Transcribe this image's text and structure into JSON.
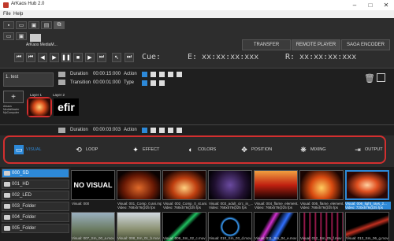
{
  "window": {
    "title": "ArKaos Hub 2.0"
  },
  "menu": [
    "File",
    "Help"
  ],
  "top_tabs": [
    "TRANSFER",
    "REMOTE PLAYER",
    "SAGA ENCODER"
  ],
  "app_label": "ArKaos MediaM...",
  "timecodes": {
    "cue": "Cue:",
    "e": "E: xx:xx:xx:xxx",
    "r": "R: xx:xx:xx:xxx"
  },
  "layer1": {
    "name": "1. test",
    "duration_label": "Duration",
    "duration_value": "00:00:15:000",
    "transition_label": "Transition",
    "transition_value": "00:00:01:000",
    "action_label": "Action",
    "type_label": "Type",
    "layer_tags": [
      "Layer 1",
      "Layer 2"
    ],
    "side_text": "Arkaos MediaMaster MyComputer"
  },
  "layer2": {
    "duration_label": "Duration",
    "duration_value": "00:00:03:003",
    "action_label": "Action"
  },
  "effects_tabs": [
    "VISUAL",
    "LOOP",
    "EFFECT",
    "COLORS",
    "POSITION",
    "MIXING",
    "OUTPUT"
  ],
  "folders": [
    "000_SD",
    "001_HD",
    "002_LED",
    "003_Folder",
    "004_Folder",
    "005_Folder"
  ],
  "thumbs_row1": [
    {
      "title": "Visual: 000",
      "sub": ""
    },
    {
      "title": "Visual: 001_Comp_0.ani.mp4",
      "sub": "Video: 768x576@25 fps"
    },
    {
      "title": "Visual: 002_Comp_0_st.ani.mp4",
      "sub": "Video: 768x576@25 fps"
    },
    {
      "title": "Visual: 003_adult_circ_in_...",
      "sub": "Video: 768x576@25 fps"
    },
    {
      "title": "Visual: 004_flame_element...",
      "sub": "Video: 768x576@25 fps"
    },
    {
      "title": "Visual: 005_flame_element...",
      "sub": "Video: 768x576@25 fps"
    },
    {
      "title": "Visual: 006_light_rays_2...",
      "sub": "Video: 720x576@25 fps"
    }
  ],
  "thumbs_row2": [
    {
      "title": "Visual: 007_Sm_00_a.mov"
    },
    {
      "title": "Visual: 008_Sm_01_b.mov"
    },
    {
      "title": "Visual: 009_Sm_02_c.mov"
    },
    {
      "title": "Visual: 010_Sm_03_d.mov"
    },
    {
      "title": "Visual: 011_Sm_04_e.mov"
    },
    {
      "title": "Visual: 012_Sm_05_f.mov"
    },
    {
      "title": "Visual: 013_Sm_06_g.mov"
    }
  ],
  "no_visual": "NO VISUAL",
  "thumb_preview": "efir",
  "colors": {
    "accent": "#2d89d8",
    "highlight": "#d32f2f"
  }
}
